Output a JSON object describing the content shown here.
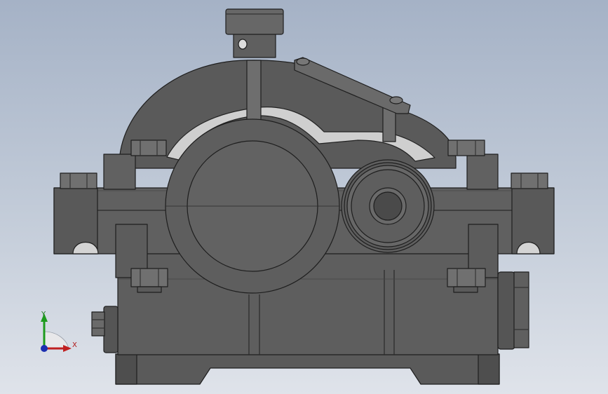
{
  "viewport": {
    "background_top": "#a5b2c6",
    "background_bottom": "#dfe3ea"
  },
  "model": {
    "body_color": "#5d5d5d",
    "dark_color": "#3c3c3c",
    "highlight_color": "#cfcfcf"
  },
  "triad": {
    "y_label": "Y",
    "x_label": "X",
    "y_color": "#1e9b1e",
    "x_color": "#c02020",
    "z_color": "#1c2fb0"
  }
}
